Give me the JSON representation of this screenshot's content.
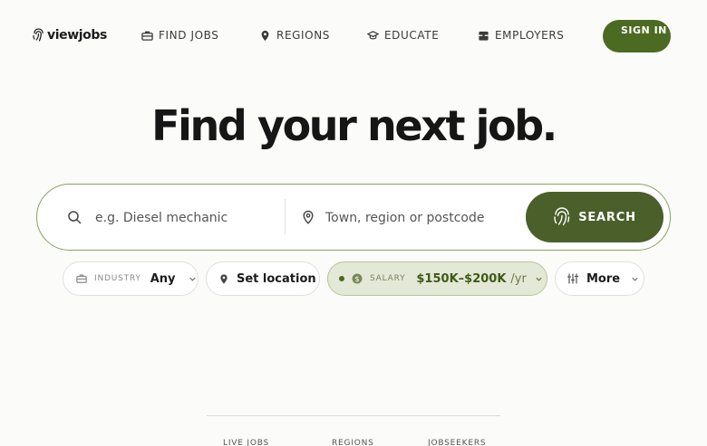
{
  "nav": {
    "logo_text": "viewjobs",
    "items": [
      {
        "label": "FIND JOBS",
        "icon": "briefcase-icon"
      },
      {
        "label": "REGIONS",
        "icon": "map-pin-icon"
      },
      {
        "label": "EDUCATE",
        "icon": "graduation-cap-icon"
      },
      {
        "label": "EMPLOYERS",
        "icon": "building-icon"
      }
    ],
    "signin_label": "SIGN IN"
  },
  "hero": {
    "title": "Find your next job."
  },
  "search": {
    "keyword_placeholder": "e.g. Diesel mechanic",
    "keyword_value": "",
    "location_placeholder": "Town, region or postcode",
    "location_value": "",
    "button_label": "SEARCH"
  },
  "filters": {
    "industry": {
      "label": "INDUSTRY",
      "value": "Any"
    },
    "location": {
      "value": "Set location"
    },
    "salary": {
      "label": "SALARY",
      "value": "$150K–$200K",
      "unit": "/yr"
    },
    "more": {
      "value": "More"
    }
  },
  "stats": {
    "labels": [
      "LIVE JOBS",
      "REGIONS",
      "JOBSEEKERS"
    ]
  },
  "colors": {
    "brand_green": "#4a5f2a",
    "accent_border": "#8aa05f",
    "salary_chip_bg": "#e4e8d6"
  }
}
